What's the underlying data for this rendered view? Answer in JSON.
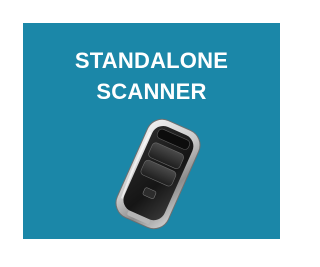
{
  "tile": {
    "title_line1": "STANDALONE",
    "title_line2": "SCANNER",
    "background_color": "#1b87a8",
    "text_color": "#ffffff",
    "image_icon": "barcode-scanner-device"
  }
}
